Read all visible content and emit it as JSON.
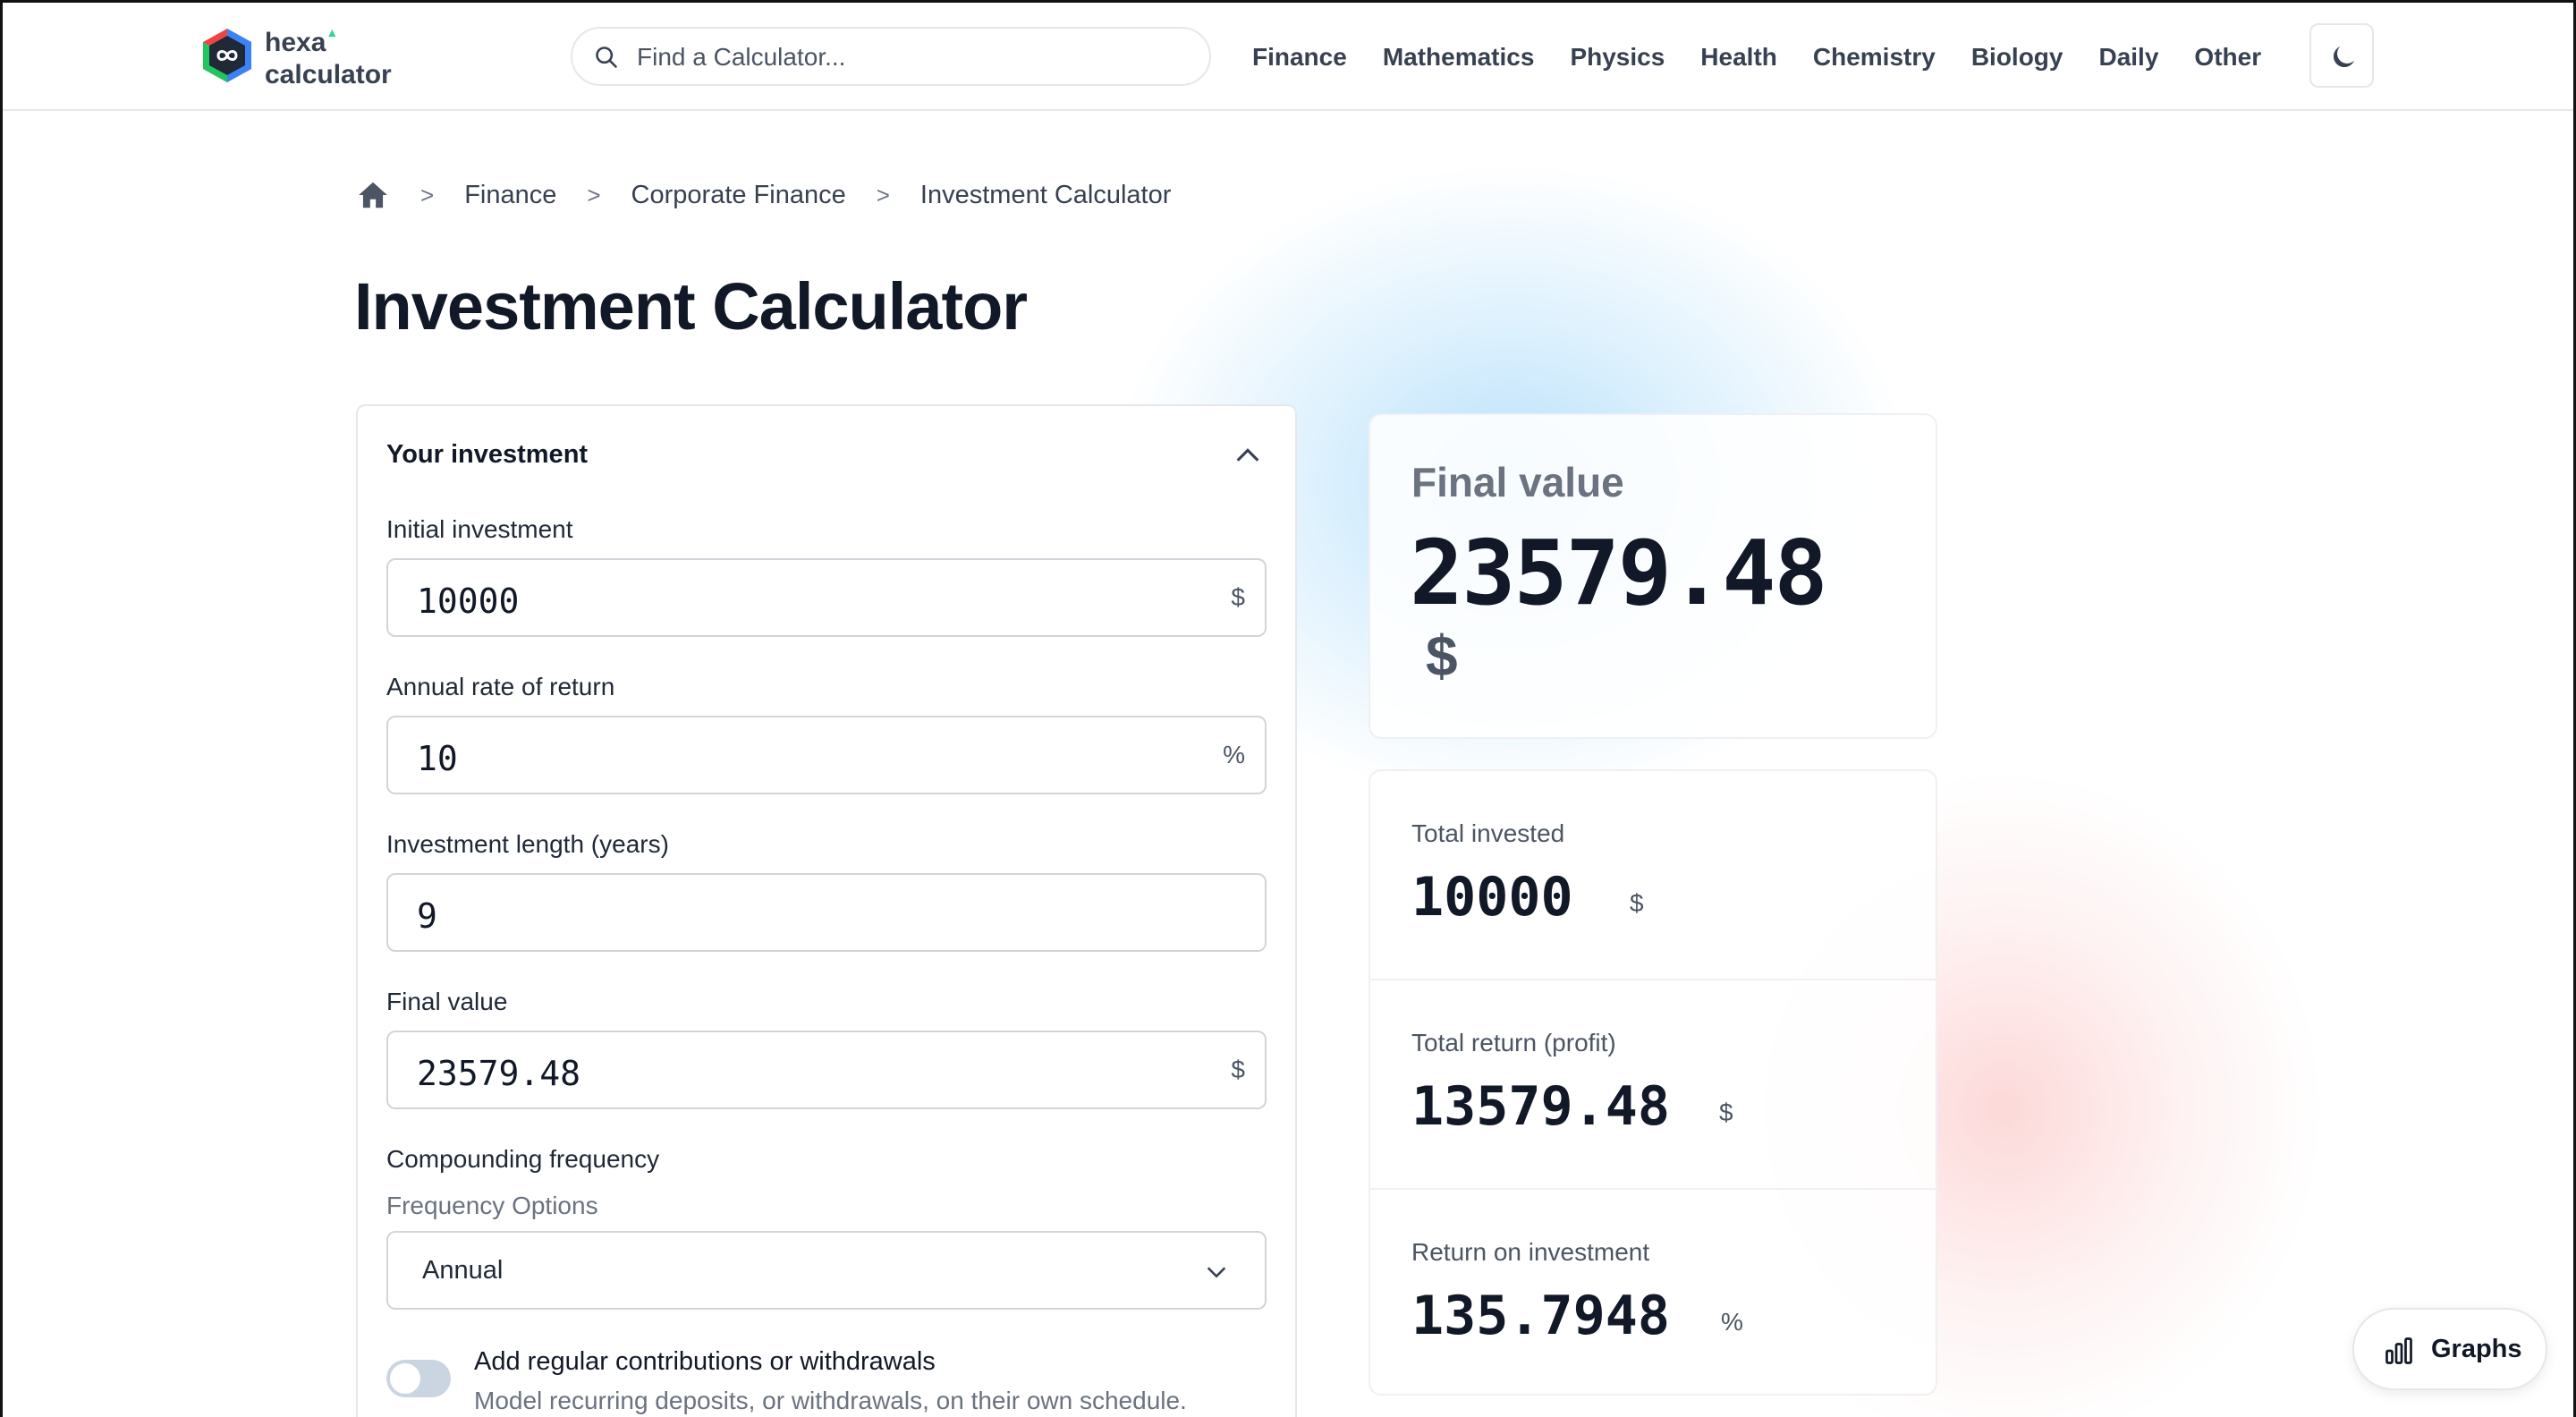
{
  "brand": {
    "line1": "hexa",
    "line2": "calculator"
  },
  "search": {
    "placeholder": "Find a Calculator..."
  },
  "nav": [
    "Finance",
    "Mathematics",
    "Physics",
    "Health",
    "Chemistry",
    "Biology",
    "Daily",
    "Other"
  ],
  "breadcrumb": [
    "Finance",
    "Corporate Finance",
    "Investment Calculator"
  ],
  "page_title": "Investment Calculator",
  "form": {
    "section_title": "Your investment",
    "initial_investment": {
      "label": "Initial investment",
      "value": "10000",
      "unit": "$"
    },
    "annual_rate": {
      "label": "Annual rate of return",
      "value": "10",
      "unit": "%"
    },
    "length": {
      "label": "Investment length (years)",
      "value": "9"
    },
    "final_value": {
      "label": "Final value",
      "value": "23579.48",
      "unit": "$"
    },
    "compounding": {
      "label": "Compounding frequency",
      "sublabel": "Frequency Options",
      "value": "Annual"
    },
    "contributions": {
      "title": "Add regular contributions or withdrawals",
      "description": "Model recurring deposits, or withdrawals, on their own schedule.",
      "enabled": false
    }
  },
  "result": {
    "label": "Final value",
    "value": "23579.48",
    "unit": "$"
  },
  "stats": [
    {
      "label": "Total invested",
      "value": "10000",
      "unit": "$"
    },
    {
      "label": "Total return (profit)",
      "value": "13579.48",
      "unit": "$"
    },
    {
      "label": "Return on investment",
      "value": "135.7948",
      "unit": "%"
    }
  ],
  "graphs_button": "Graphs",
  "colors": {
    "accent_blue": "#7dc8f8",
    "accent_red": "#faaaaa",
    "toggle_off": "#cbd5e1",
    "logo_green": "#34d399"
  }
}
